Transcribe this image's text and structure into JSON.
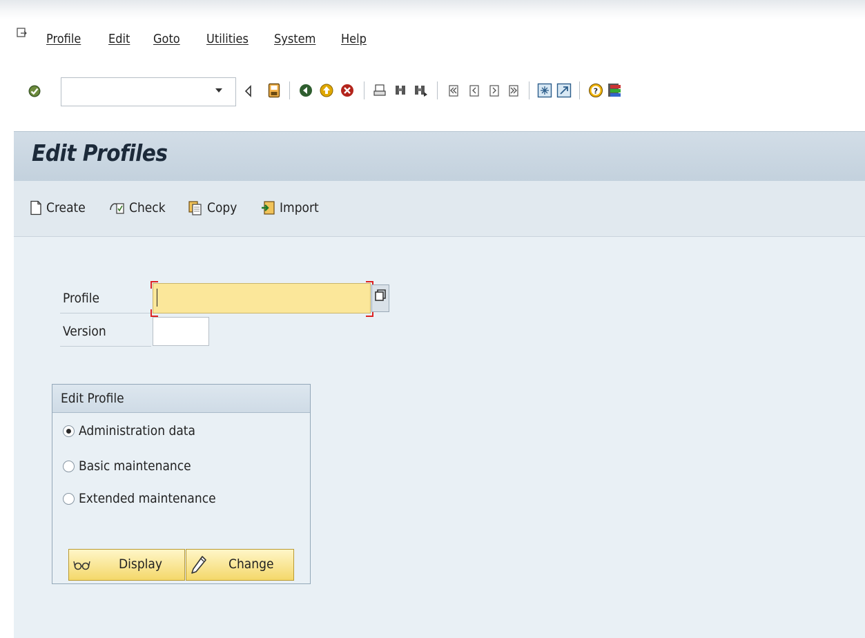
{
  "menu": {
    "items": [
      "Profile",
      "Edit",
      "Goto",
      "Utilities",
      "System",
      "Help"
    ]
  },
  "toolbar": {
    "command_field_value": "",
    "icons": [
      "check-icon",
      "command-dropdown-icon",
      "back-triangle-icon",
      "save-icon",
      "back-icon",
      "exit-icon",
      "cancel-icon",
      "print-icon",
      "find-icon",
      "find-next-icon",
      "first-page-icon",
      "previous-page-icon",
      "next-page-icon",
      "last-page-icon",
      "new-session-icon",
      "shortcut-icon",
      "help-icon",
      "customize-layout-icon"
    ]
  },
  "page": {
    "title": "Edit Profiles"
  },
  "app_toolbar": {
    "create": "Create",
    "check": "Check",
    "copy": "Copy",
    "import": "Import"
  },
  "form": {
    "profile_label": "Profile",
    "profile_value": "",
    "version_label": "Version",
    "version_value": ""
  },
  "group": {
    "title": "Edit Profile",
    "options": [
      {
        "label": "Administration data",
        "selected": true
      },
      {
        "label": "Basic maintenance",
        "selected": false
      },
      {
        "label": "Extended maintenance",
        "selected": false
      }
    ],
    "display_button": "Display",
    "change_button": "Change"
  },
  "colors": {
    "title_bar": "#c7d4e0",
    "app_toolbar": "#e1e9ef",
    "main_bg": "#e9f0f5",
    "required_field": "#fbe79a",
    "button": "#f4d86a"
  }
}
